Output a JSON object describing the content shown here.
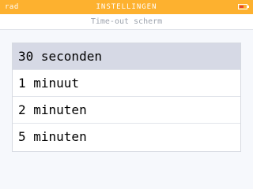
{
  "status_bar": {
    "left_label": "rad",
    "title": "INSTELLINGEN",
    "battery_icon": "battery-low-icon",
    "background": "#fdb12f"
  },
  "header": {
    "subtitle": "Time-out scherm"
  },
  "options": [
    {
      "label": "30 seconden",
      "selected": true
    },
    {
      "label": "1 minuut",
      "selected": false
    },
    {
      "label": "2 minuten",
      "selected": false
    },
    {
      "label": "5 minuten",
      "selected": false
    }
  ],
  "colors": {
    "accent": "#fdb12f",
    "selected_row": "#d6d9e5",
    "battery_level": "#e8462f"
  }
}
